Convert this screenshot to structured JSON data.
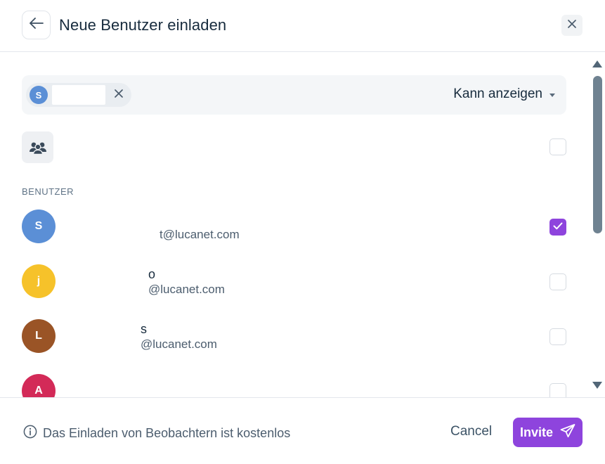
{
  "header": {
    "title": "Neue Benutzer einladen"
  },
  "selection": {
    "chip_initial": "S",
    "chip_avatar_color": "#5b8fd6",
    "permission_label": "Kann anzeigen"
  },
  "section": {
    "users_label": "BENUTZER"
  },
  "users": [
    {
      "initial": "S",
      "color": "#5b8fd6",
      "name": "",
      "email": "t@lucanet.com",
      "checked": true
    },
    {
      "initial": "j",
      "color": "#f6c22a",
      "name": "o",
      "email": "@lucanet.com",
      "checked": false
    },
    {
      "initial": "L",
      "color": "#9a5426",
      "name": "s",
      "email": "@lucanet.com",
      "checked": false
    },
    {
      "initial": "A",
      "color": "#d32a58",
      "name": "",
      "email": "",
      "checked": false
    }
  ],
  "footer": {
    "info_text": "Das Einladen von Beobachtern ist kostenlos",
    "cancel_label": "Cancel",
    "invite_label": "Invite"
  },
  "colors": {
    "accent": "#8e44dd"
  }
}
